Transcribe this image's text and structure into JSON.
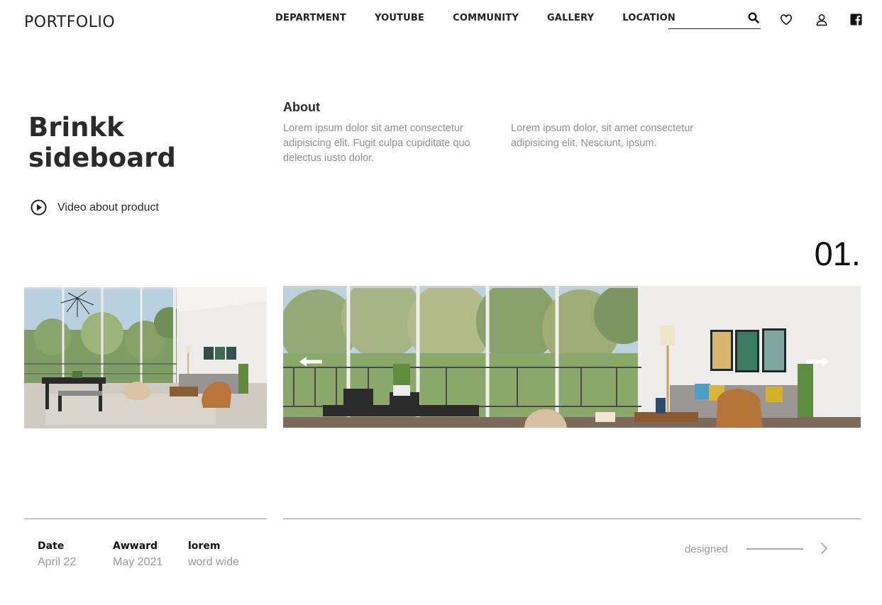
{
  "header": {
    "logo": "PORTFOLIO",
    "nav": [
      "DEPARTMENT",
      "YOUTUBE",
      "COMMUNITY",
      "GALLERY",
      "LOCATION"
    ],
    "search": {
      "value": "",
      "placeholder": ""
    },
    "icons": [
      "search-icon",
      "heart-icon",
      "user-icon",
      "facebook-icon"
    ]
  },
  "hero": {
    "title_line1": "Brinkk",
    "title_line2": "sideboard",
    "video_label": "Video about product"
  },
  "about": {
    "heading": "About",
    "para1": "Lorem ipsum dolor sit amet consectetur adipisicing elit. Fugit culpa cupiditate quo delectus iusto dolor.",
    "para2": "Lorem ipsum dolor, sit amet consectetur adipisicing elit. Nesciunt, ipsum."
  },
  "slider": {
    "number": "01.",
    "controls": [
      "arrow-left-icon",
      "arrow-right-icon"
    ]
  },
  "footer": {
    "meta": [
      {
        "key": "Date",
        "value": "April 22"
      },
      {
        "key": "Awward",
        "value": "May 2021"
      },
      {
        "key": "lorem",
        "value": "word wide"
      }
    ],
    "designed": "designed"
  },
  "colors": {
    "text_dark": "#2a2a2a",
    "text_muted": "#8f8f8f",
    "rule": "#9a9a9a"
  }
}
